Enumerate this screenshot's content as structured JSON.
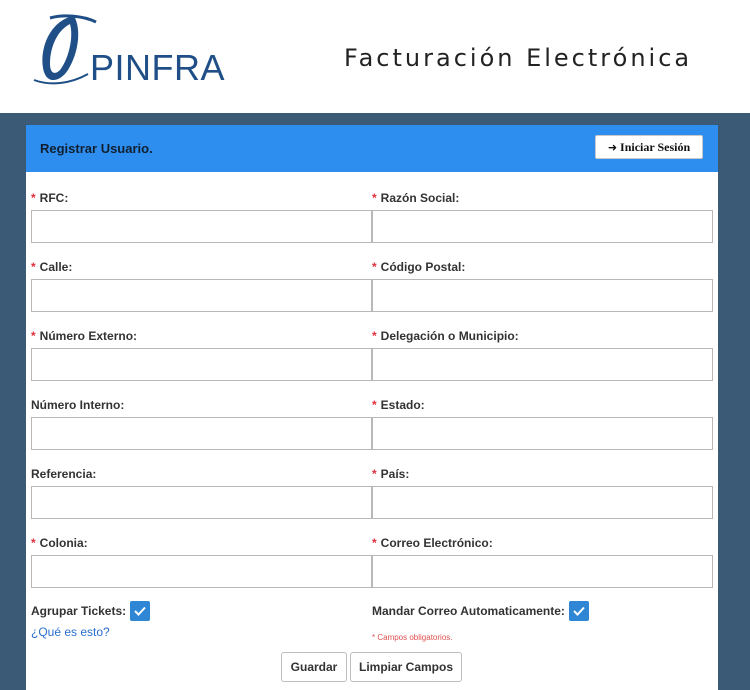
{
  "header": {
    "logo_text": "PINFRA",
    "title": "Facturación Electrónica"
  },
  "panel": {
    "title": "Registrar Usuario.",
    "login_button": "Iniciar Sesión",
    "login_icon": "sign-in-icon"
  },
  "form": {
    "required_marker": "*",
    "fields": [
      {
        "label": "RFC:",
        "required": true,
        "value": ""
      },
      {
        "label": "Razón Social:",
        "required": true,
        "value": ""
      },
      {
        "label": "Calle:",
        "required": true,
        "value": ""
      },
      {
        "label": "Código Postal:",
        "required": true,
        "value": ""
      },
      {
        "label": "Número Externo:",
        "required": true,
        "value": ""
      },
      {
        "label": "Delegación o Municipio:",
        "required": true,
        "value": ""
      },
      {
        "label": "Número Interno:",
        "required": false,
        "value": ""
      },
      {
        "label": "Estado:",
        "required": true,
        "value": ""
      },
      {
        "label": "Referencia:",
        "required": false,
        "value": ""
      },
      {
        "label": "País:",
        "required": true,
        "value": ""
      },
      {
        "label": "Colonia:",
        "required": true,
        "value": ""
      },
      {
        "label": "Correo Electrónico:",
        "required": true,
        "value": ""
      }
    ],
    "group_tickets_label": "Agrupar Tickets:",
    "group_tickets_checked": true,
    "auto_mail_label": "Mandar Correo Automaticamente:",
    "auto_mail_checked": true,
    "help_link": "¿Qué es esto?",
    "required_note": "* Campos obligatorios.",
    "save_button": "Guardar",
    "clear_button": "Limpiar Campos"
  },
  "colors": {
    "panel_header": "#2e8ef0",
    "backdrop": "#3a5a75",
    "checkbox": "#2e86d4",
    "logo": "#1f4f86",
    "required": "#e0303a"
  }
}
